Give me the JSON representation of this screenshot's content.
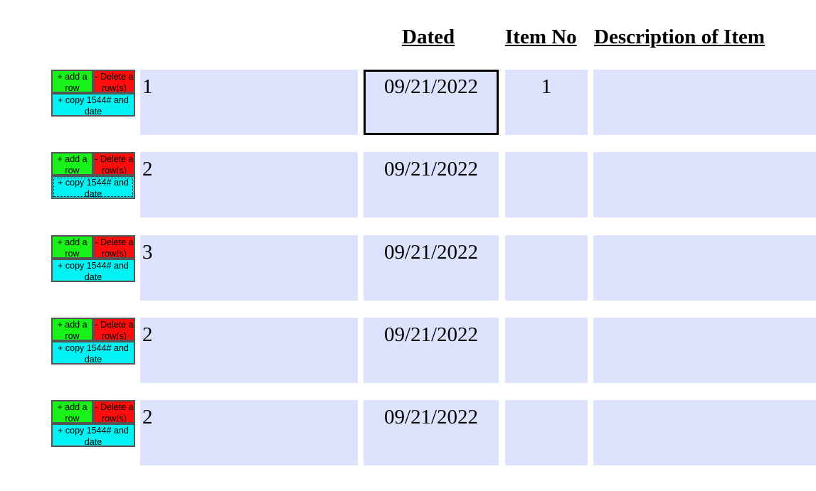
{
  "headers": {
    "dated": "Dated",
    "item_no": "Item No",
    "description": "Description of Item"
  },
  "buttons": {
    "add_row": "+ add a row",
    "delete_rows": "- Delete a row(s)",
    "copy_1544_and_date": "+ copy 1544# and date"
  },
  "rows": [
    {
      "number": "1",
      "dated": "09/21/2022",
      "item_no": "1",
      "description": ""
    },
    {
      "number": "2",
      "dated": "09/21/2022",
      "item_no": "",
      "description": ""
    },
    {
      "number": "3",
      "dated": "09/21/2022",
      "item_no": "",
      "description": ""
    },
    {
      "number": "2",
      "dated": "09/21/2022",
      "item_no": "",
      "description": ""
    },
    {
      "number": "2",
      "dated": "09/21/2022",
      "item_no": "",
      "description": ""
    }
  ],
  "colors": {
    "add_button": "#19f219",
    "delete_button": "#ff0d0d",
    "copy_button": "#00f2f2",
    "field_background": "#dde3fd"
  }
}
